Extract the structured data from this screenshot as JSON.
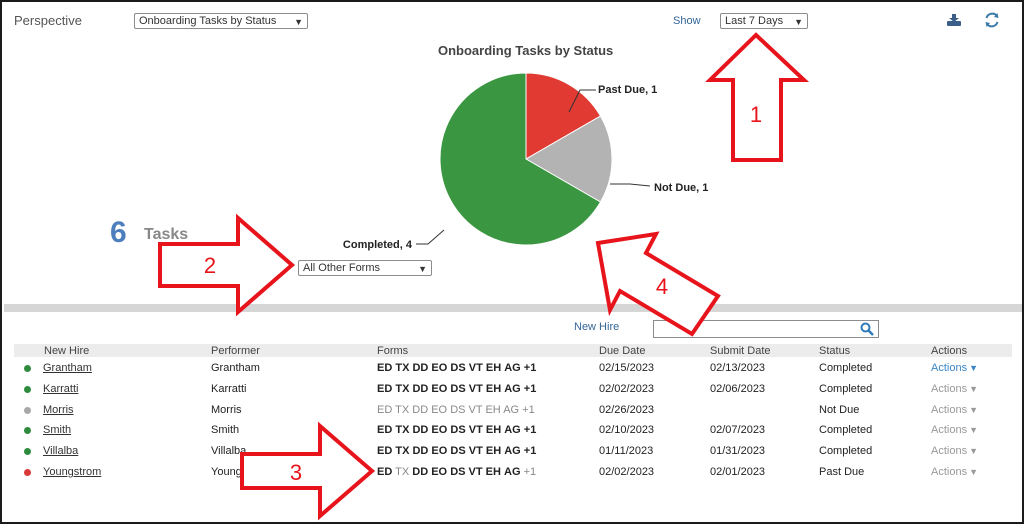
{
  "toolbar": {
    "perspective_label": "Perspective",
    "perspective_value": "Onboarding Tasks by Status",
    "show_label": "Show",
    "range_value": "Last 7 Days",
    "export_icon": "export-icon",
    "refresh_icon": "refresh-icon"
  },
  "summary": {
    "count": "6",
    "label": "Tasks",
    "forms_filter_value": "All Other Forms"
  },
  "chart_data": {
    "type": "pie",
    "title": "Onboarding Tasks by Status",
    "slices": [
      {
        "label": "Past Due",
        "value": 1,
        "text": "Past Due, 1",
        "color": "#e03a33"
      },
      {
        "label": "Not Due",
        "value": 1,
        "text": "Not Due, 1",
        "color": "#b3b3b3"
      },
      {
        "label": "Completed",
        "value": 4,
        "text": "Completed, 4",
        "color": "#3a9640"
      }
    ]
  },
  "search": {
    "label": "New Hire",
    "value": "",
    "icon": "search-icon"
  },
  "table": {
    "columns": [
      "New Hire",
      "Performer",
      "Forms",
      "Due Date",
      "Submit Date",
      "Status",
      "Actions"
    ],
    "rows": [
      {
        "status_color": "#2e8b3e",
        "new_hire": "Grantham",
        "performer": "Grantham",
        "forms": [
          [
            "ED",
            "b"
          ],
          [
            "TX",
            "b"
          ],
          [
            "DD",
            "b"
          ],
          [
            "EO",
            "b"
          ],
          [
            "DS",
            "b"
          ],
          [
            "VT",
            "b"
          ],
          [
            "EH",
            "b"
          ],
          [
            "AG",
            "b"
          ],
          [
            "+1",
            "b"
          ]
        ],
        "due": "02/15/2023",
        "submit": "02/13/2023",
        "status": "Completed",
        "actions": "Actions",
        "actions_active": true
      },
      {
        "status_color": "#2e8b3e",
        "new_hire": "Karratti",
        "performer": "Karratti",
        "forms": [
          [
            "ED",
            "b"
          ],
          [
            "TX",
            "b"
          ],
          [
            "DD",
            "b"
          ],
          [
            "EO",
            "b"
          ],
          [
            "DS",
            "b"
          ],
          [
            "VT",
            "b"
          ],
          [
            "EH",
            "b"
          ],
          [
            "AG",
            "b"
          ],
          [
            "+1",
            "b"
          ]
        ],
        "due": "02/02/2023",
        "submit": "02/06/2023",
        "status": "Completed",
        "actions": "Actions",
        "actions_active": false
      },
      {
        "status_color": "#a8a8a8",
        "new_hire": "Morris",
        "performer": "Morris",
        "forms": [
          [
            "ED",
            "d"
          ],
          [
            "TX",
            "d"
          ],
          [
            "DD",
            "d"
          ],
          [
            "EO",
            "d"
          ],
          [
            "DS",
            "d"
          ],
          [
            "VT",
            "d"
          ],
          [
            "EH",
            "d"
          ],
          [
            "AG",
            "d"
          ],
          [
            "+1",
            "d"
          ]
        ],
        "due": "02/26/2023",
        "submit": "",
        "status": "Not Due",
        "actions": "Actions",
        "actions_active": false
      },
      {
        "status_color": "#2e8b3e",
        "new_hire": "Smith",
        "performer": "Smith",
        "forms": [
          [
            "ED",
            "b"
          ],
          [
            "TX",
            "b"
          ],
          [
            "DD",
            "b"
          ],
          [
            "EO",
            "b"
          ],
          [
            "DS",
            "b"
          ],
          [
            "VT",
            "b"
          ],
          [
            "EH",
            "b"
          ],
          [
            "AG",
            "b"
          ],
          [
            "+1",
            "b"
          ]
        ],
        "due": "02/10/2023",
        "submit": "02/07/2023",
        "status": "Completed",
        "actions": "Actions",
        "actions_active": false
      },
      {
        "status_color": "#2e8b3e",
        "new_hire": "Villalba",
        "performer": "Villalba",
        "forms": [
          [
            "ED",
            "b"
          ],
          [
            "TX",
            "b"
          ],
          [
            "DD",
            "b"
          ],
          [
            "EO",
            "b"
          ],
          [
            "DS",
            "b"
          ],
          [
            "VT",
            "b"
          ],
          [
            "EH",
            "b"
          ],
          [
            "AG",
            "b"
          ],
          [
            "+1",
            "b"
          ]
        ],
        "due": "01/11/2023",
        "submit": "01/31/2023",
        "status": "Completed",
        "actions": "Actions",
        "actions_active": false
      },
      {
        "status_color": "#d93a3a",
        "new_hire": "Youngstrom",
        "performer": "Youngstrom",
        "forms": [
          [
            "ED",
            "b"
          ],
          [
            "TX",
            "d"
          ],
          [
            "DD",
            "b"
          ],
          [
            "EO",
            "b"
          ],
          [
            "DS",
            "b"
          ],
          [
            "VT",
            "b"
          ],
          [
            "EH",
            "b"
          ],
          [
            "AG",
            "b"
          ],
          [
            "+1",
            "d"
          ]
        ],
        "due": "02/02/2023",
        "submit": "02/01/2023",
        "status": "Past Due",
        "actions": "Actions",
        "actions_active": false
      }
    ]
  },
  "annotations": {
    "callout_1": "1",
    "callout_2": "2",
    "callout_3": "3",
    "callout_4": "4",
    "arrow_color": "#e8141c"
  }
}
